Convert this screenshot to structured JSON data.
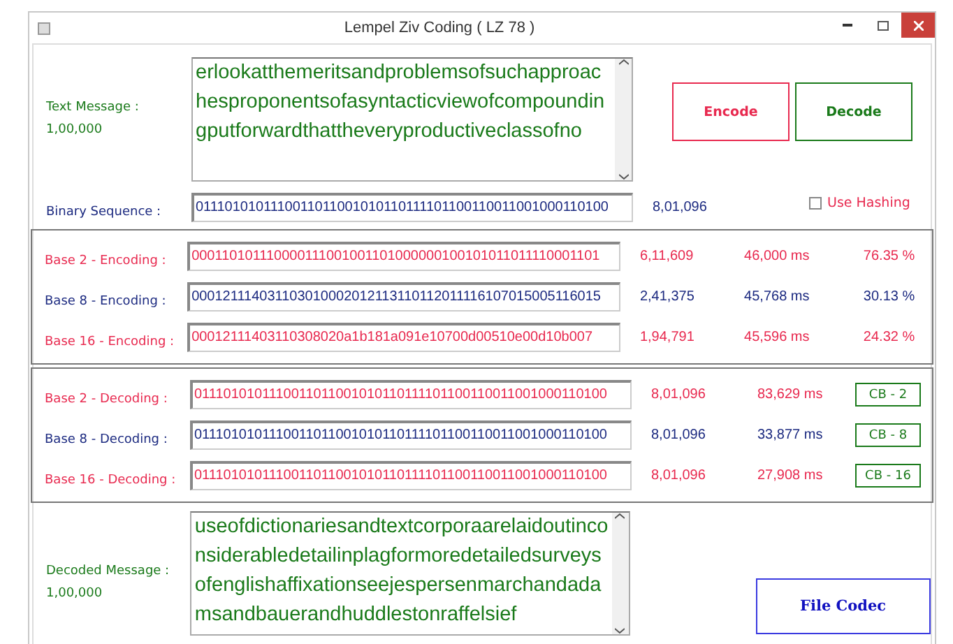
{
  "window": {
    "title": "Lempel Ziv Coding ( LZ 78 )"
  },
  "text_message": {
    "label": "Text Message :",
    "count": "1,00,000",
    "value": "erlookatthemeritsandproblemsofsuchapproachesproponentsofasyntacticviewofcompoundingputforwardthattheveryproductiveclassofno"
  },
  "buttons": [
    {
      "label": "Encode",
      "color": "#e8294f"
    },
    {
      "label": "Decode",
      "color": "#1a7a1a"
    }
  ],
  "binary": {
    "label": "Binary Sequence :",
    "value": "0111010101110011011001010110111101100110011001000110100",
    "count": "8,01,096"
  },
  "use_hashing": {
    "label": "Use Hashing",
    "checked": false
  },
  "encoding_rows": [
    {
      "label": "Base 2 - Encoding :",
      "value": "000110101110000111001001101000000100101011011110001101",
      "count": "6,11,609",
      "time": "46,000 ms",
      "ratio": "76.35 %",
      "color": "#e8294f"
    },
    {
      "label": "Base 8 - Encoding :",
      "value": "000121114031103010002012113110112011116107015005116015",
      "count": "2,41,375",
      "time": "45,768 ms",
      "ratio": "30.13 %",
      "color": "#1c2a80"
    },
    {
      "label": "Base 16 - Encoding :",
      "value": "00012111403110308020a1b181a091e10700d00510e00d10b007",
      "count": "1,94,791",
      "time": "45,596 ms",
      "ratio": "24.32 %",
      "color": "#e8294f"
    }
  ],
  "decoding_rows": [
    {
      "label": "Base 2 - Decoding :",
      "value": "0111010101110011011001010110111101100110011001000110100",
      "count": "8,01,096",
      "time": "83,629 ms",
      "button": "CB - 2",
      "color": "#e8294f"
    },
    {
      "label": "Base 8 - Decoding :",
      "value": "0111010101110011011001010110111101100110011001000110100",
      "count": "8,01,096",
      "time": "33,877 ms",
      "button": "CB - 8",
      "color": "#1c2a80"
    },
    {
      "label": "Base 16 - Decoding :",
      "value": "0111010101110011011001010110111101100110011001000110100",
      "count": "8,01,096",
      "time": "27,908 ms",
      "button": "CB - 16",
      "color": "#e8294f"
    }
  ],
  "decoded_message": {
    "label": "Decoded Message :",
    "count": "1,00,000",
    "value": "useofdictionariesandtextcorporaarelaidoutinconsiderabledetailinplagformoredetailedsurveysofenglishaffixationseejespersenmarchandadamsandbauerandhuddlestonraffelsief"
  },
  "file_codec": {
    "label": "File Codec"
  }
}
